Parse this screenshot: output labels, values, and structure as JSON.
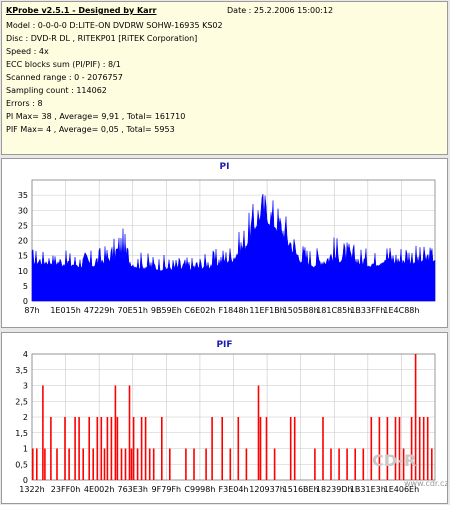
{
  "info": {
    "title": "KProbe v2.5.1 - Designed by Karr",
    "date": "Date : 25.2.2006 15:00:12",
    "lines": [
      "Model : 0-0-0-0 D:LITE-ON DVDRW SOHW-16935 KS02",
      "Disc : DVD-R DL , RITEKP01 [RiTEK Corporation]",
      "Speed : 4x",
      "ECC blocks sum (PI/PIF) : 8/1",
      "Scanned range : 0 - 2076757",
      "Sampling count : 114062",
      "Errors : 8",
      "PI Max= 38 , Average= 9,91 , Total= 161710",
      "PIF Max= 4 , Average= 0,05 , Total= 5953"
    ]
  },
  "watermark": {
    "text": "CD-R",
    "url": "www.cdr.cz"
  },
  "colors": {
    "pi": "#0000ff",
    "pif": "#ff0000",
    "title": "#1c1cb4"
  },
  "chart_data": [
    {
      "type": "area",
      "title": "PI",
      "ylim": [
        0,
        40
      ],
      "yticks": [
        0,
        5,
        10,
        15,
        20,
        25,
        30,
        35
      ],
      "xticklabels": [
        "87h",
        "1E015h",
        "47229h",
        "70E51h",
        "9B59Eh",
        "C6E02h",
        "F1848h",
        "11EF1Bh",
        "1505B8h",
        "181C85h",
        "1B33FFh",
        "1E4C88h"
      ],
      "grid": true,
      "series": [
        {
          "color": "#0000ff",
          "segments": [
            [
              0,
              12,
              18
            ],
            [
              0.05,
              12,
              16
            ],
            [
              0.1,
              11,
              17
            ],
            [
              0.15,
              11,
              17
            ],
            [
              0.2,
              13,
              20
            ],
            [
              0.22,
              14,
              26
            ],
            [
              0.25,
              11,
              17
            ],
            [
              0.3,
              10,
              16
            ],
            [
              0.35,
              10,
              15
            ],
            [
              0.4,
              10,
              15
            ],
            [
              0.45,
              11,
              17
            ],
            [
              0.5,
              13,
              20
            ],
            [
              0.53,
              17,
              27
            ],
            [
              0.55,
              22,
              33
            ],
            [
              0.56,
              25,
              36
            ],
            [
              0.57,
              27,
              38
            ],
            [
              0.58,
              26,
              37
            ],
            [
              0.6,
              24,
              35
            ],
            [
              0.62,
              21,
              32
            ],
            [
              0.64,
              17,
              28
            ],
            [
              0.66,
              13,
              21
            ],
            [
              0.7,
              11,
              18
            ],
            [
              0.73,
              12,
              20
            ],
            [
              0.75,
              13,
              22
            ],
            [
              0.8,
              12,
              19
            ],
            [
              0.85,
              11,
              17
            ],
            [
              0.88,
              13,
              21
            ],
            [
              0.9,
              12,
              18
            ],
            [
              0.93,
              12,
              22
            ],
            [
              0.96,
              12,
              18
            ],
            [
              1.0,
              13,
              19
            ]
          ]
        }
      ]
    },
    {
      "type": "bar",
      "title": "PIF",
      "ylim": [
        0,
        4
      ],
      "yticks": [
        0,
        0.5,
        1,
        1.5,
        2,
        2.5,
        3,
        3.5,
        4
      ],
      "yticklabels": [
        "0",
        "0,5",
        "1",
        "1,5",
        "2",
        "2,5",
        "3",
        "3,5",
        "4"
      ],
      "xticklabels": [
        "1322h",
        "23FF0h",
        "4E002h",
        "763E3h",
        "9F79Fh",
        "C9998h",
        "F3E04h",
        "120937h",
        "1516BEh",
        "18239Dh",
        "1B31E3h",
        "1E406Eh"
      ],
      "grid": true,
      "series": [
        {
          "color": "#ff0000",
          "bars": [
            [
              0.0,
              1
            ],
            [
              0.01,
              1
            ],
            [
              0.025,
              3
            ],
            [
              0.03,
              1
            ],
            [
              0.045,
              2
            ],
            [
              0.06,
              1
            ],
            [
              0.08,
              2
            ],
            [
              0.09,
              1
            ],
            [
              0.105,
              2
            ],
            [
              0.115,
              2
            ],
            [
              0.125,
              1
            ],
            [
              0.14,
              2
            ],
            [
              0.15,
              1
            ],
            [
              0.16,
              2
            ],
            [
              0.17,
              2
            ],
            [
              0.178,
              1
            ],
            [
              0.185,
              2
            ],
            [
              0.195,
              2
            ],
            [
              0.205,
              3
            ],
            [
              0.21,
              2
            ],
            [
              0.22,
              1
            ],
            [
              0.23,
              1
            ],
            [
              0.24,
              3
            ],
            [
              0.245,
              1
            ],
            [
              0.25,
              2
            ],
            [
              0.26,
              1
            ],
            [
              0.27,
              2
            ],
            [
              0.28,
              2
            ],
            [
              0.29,
              1
            ],
            [
              0.3,
              1
            ],
            [
              0.32,
              2
            ],
            [
              0.34,
              1
            ],
            [
              0.38,
              1
            ],
            [
              0.4,
              1
            ],
            [
              0.43,
              1
            ],
            [
              0.445,
              2
            ],
            [
              0.47,
              2
            ],
            [
              0.49,
              1
            ],
            [
              0.51,
              2
            ],
            [
              0.53,
              1
            ],
            [
              0.56,
              3
            ],
            [
              0.565,
              2
            ],
            [
              0.58,
              2
            ],
            [
              0.6,
              1
            ],
            [
              0.64,
              2
            ],
            [
              0.65,
              2
            ],
            [
              0.7,
              1
            ],
            [
              0.72,
              2
            ],
            [
              0.74,
              1
            ],
            [
              0.76,
              1
            ],
            [
              0.78,
              1
            ],
            [
              0.8,
              1
            ],
            [
              0.82,
              1
            ],
            [
              0.84,
              2
            ],
            [
              0.86,
              2
            ],
            [
              0.88,
              2
            ],
            [
              0.9,
              2
            ],
            [
              0.91,
              2
            ],
            [
              0.92,
              1
            ],
            [
              0.94,
              2
            ],
            [
              0.95,
              4
            ],
            [
              0.96,
              2
            ],
            [
              0.97,
              2
            ],
            [
              0.98,
              2
            ],
            [
              0.99,
              1
            ]
          ]
        }
      ]
    }
  ]
}
